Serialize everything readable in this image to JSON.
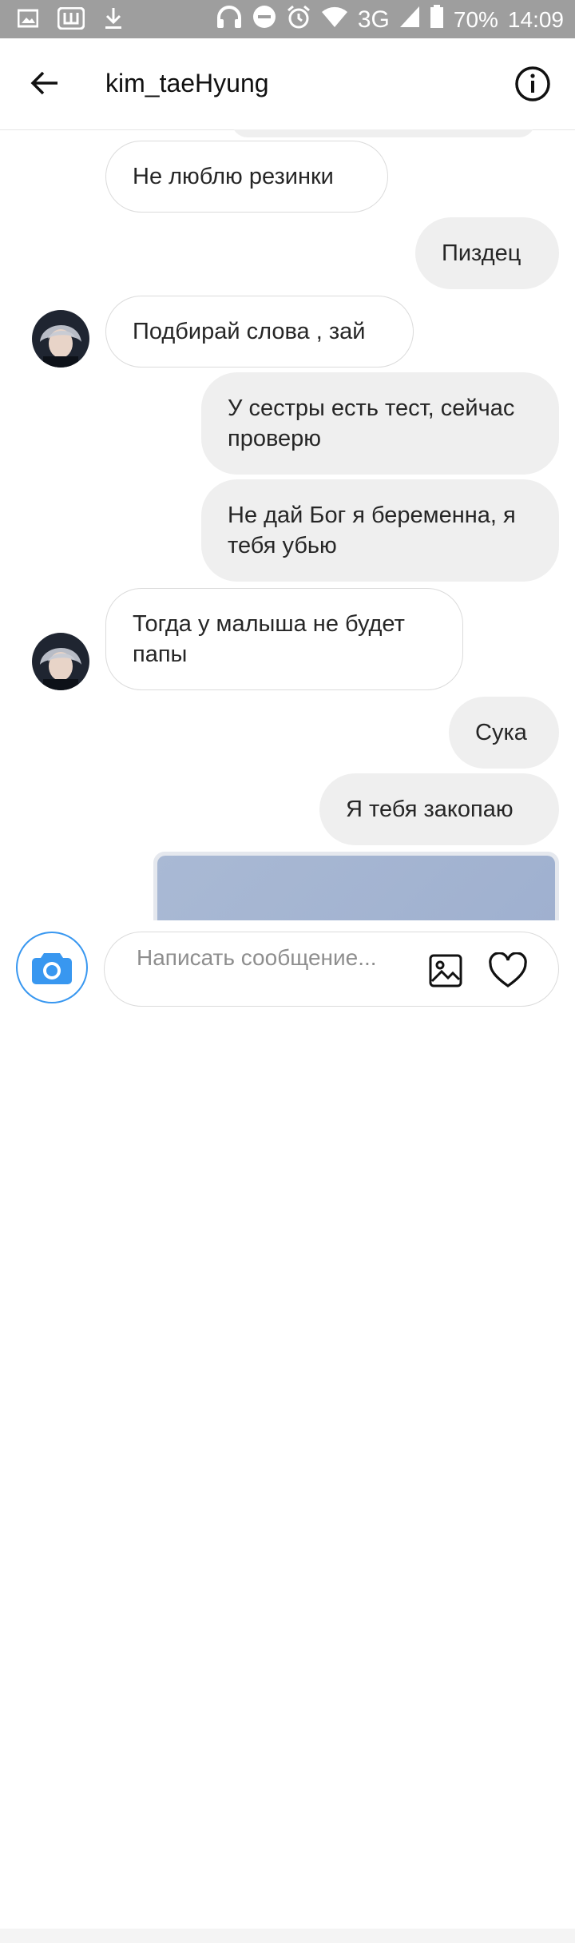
{
  "status_bar": {
    "network": "3G",
    "battery": "70%",
    "time": "14:09"
  },
  "header": {
    "title": "kim_taeHyung"
  },
  "messages": [
    {
      "text": "Не люблю резинки",
      "dir": "in"
    },
    {
      "text": "Пиздец",
      "dir": "out"
    },
    {
      "text": "Подбирай слова , зай",
      "dir": "in"
    },
    {
      "text": "У сестры есть тест, сейчас проверю",
      "dir": "out"
    },
    {
      "text": "Не дай Бог я беременна, я тебя убью",
      "dir": "out"
    },
    {
      "text": "Тогда у малыша не будет папы",
      "dir": "in"
    },
    {
      "text": "Сука",
      "dir": "out"
    },
    {
      "text": "Я тебя закопаю",
      "dir": "out"
    }
  ],
  "composer": {
    "placeholder": "Написать сообщение..."
  },
  "colors": {
    "status_bar_bg": "#9e9e9e",
    "outgoing_bubble": "#efefef",
    "incoming_border": "#dbdbdb",
    "accent_blue": "#3897f0"
  }
}
